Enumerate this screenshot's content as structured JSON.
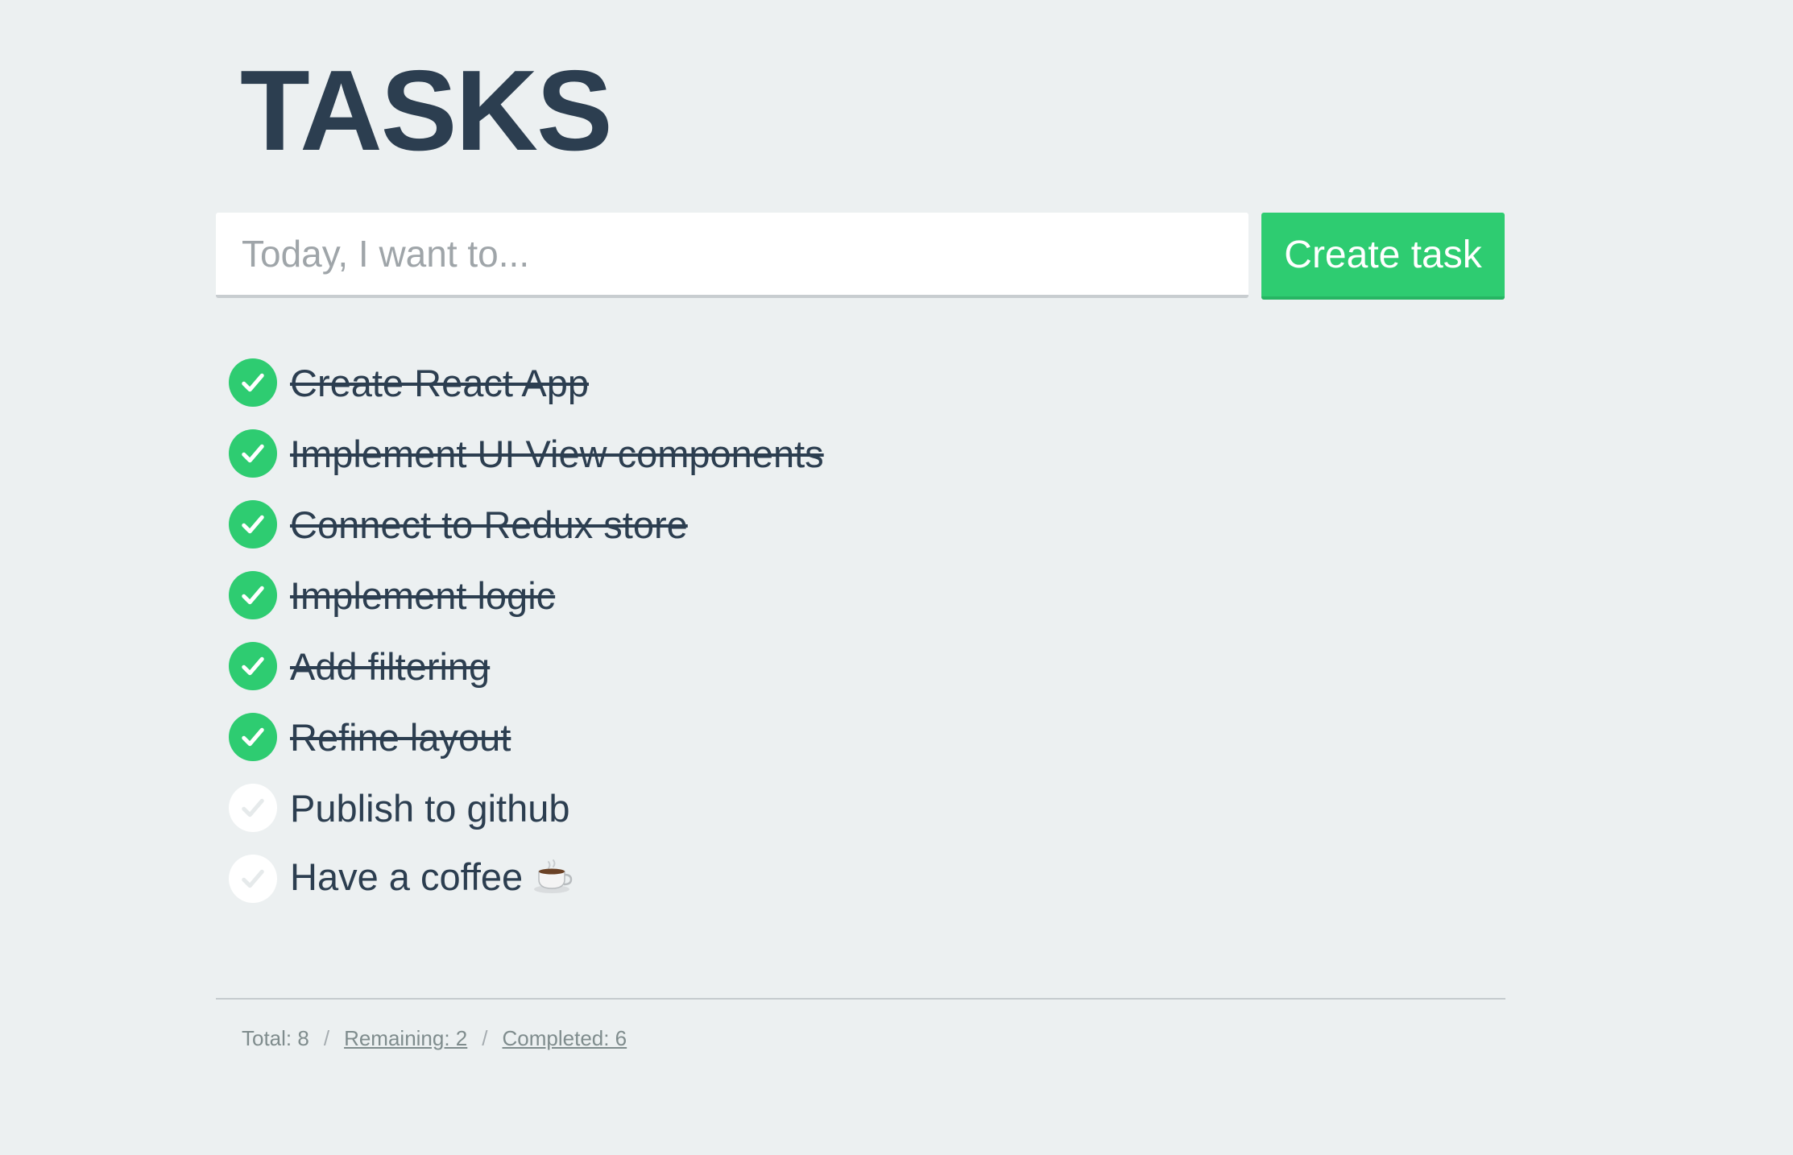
{
  "header": {
    "title": "TASKS"
  },
  "composer": {
    "placeholder": "Today, I want to...",
    "value": "",
    "button_label": "Create task"
  },
  "tasks": [
    {
      "label": "Create React App",
      "completed": true
    },
    {
      "label": "Implement UI View components",
      "completed": true
    },
    {
      "label": "Connect to Redux store",
      "completed": true
    },
    {
      "label": "Implement logic",
      "completed": true
    },
    {
      "label": "Add filtering",
      "completed": true
    },
    {
      "label": "Refine layout",
      "completed": true
    },
    {
      "label": "Publish to github",
      "completed": false
    },
    {
      "label": "Have a coffee",
      "completed": false,
      "icon": "coffee-cup-icon"
    }
  ],
  "footer": {
    "total": "Total: 8",
    "remaining": "Remaining: 2",
    "completed": "Completed: 6",
    "separator": "/"
  },
  "colors": {
    "background": "#ecf0f1",
    "text": "#2c3e50",
    "accent": "#2ecc71",
    "muted": "#7f8c8d"
  }
}
